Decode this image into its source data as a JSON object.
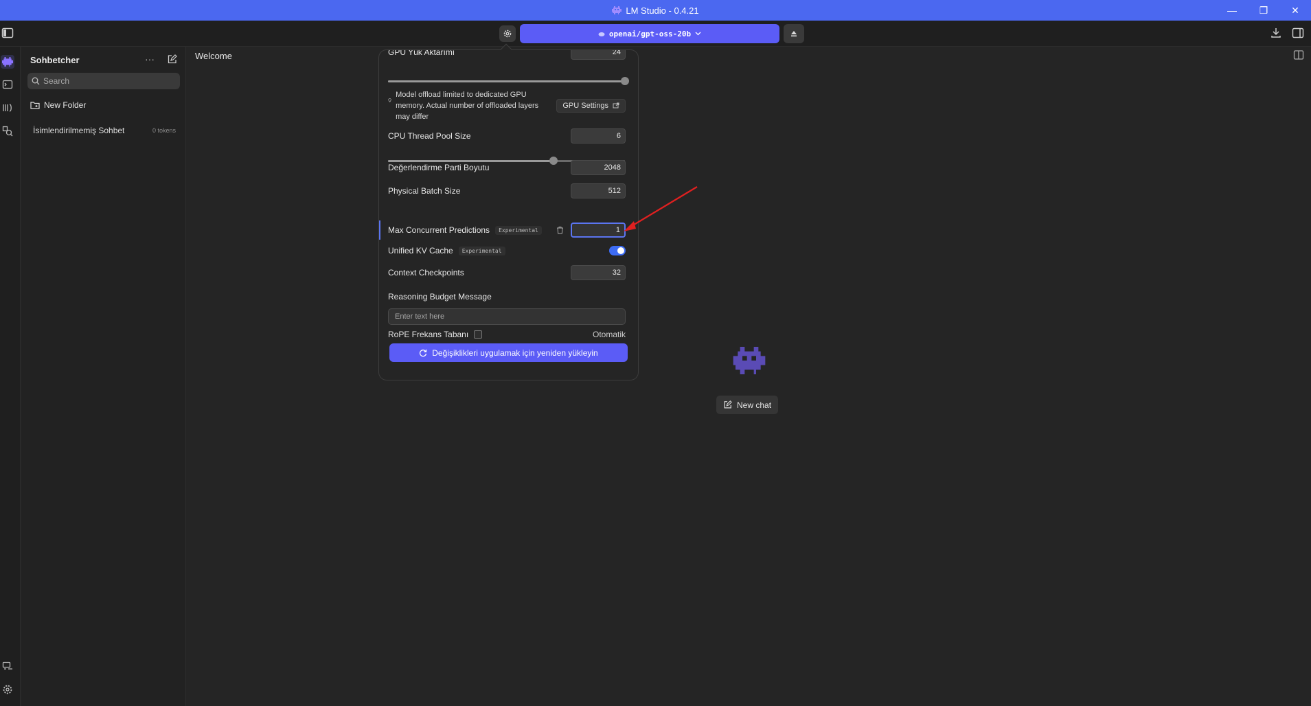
{
  "window": {
    "title": "LM Studio - 0.4.21"
  },
  "toolbar": {
    "model_name": "openai/gpt-oss-20b"
  },
  "sidebar": {
    "title": "Sohbetcher",
    "more_label": "···",
    "search_placeholder": "Search",
    "new_folder_label": "New Folder",
    "chats": [
      {
        "name": "İsimlendirilmemiş Sohbet",
        "tokens": "0 tokens"
      }
    ]
  },
  "main": {
    "tab_title": "Welcome",
    "new_chat_label": "New chat"
  },
  "settings": {
    "gpu_offload": {
      "label": "GPU Yük Aktarımı",
      "value": "24",
      "fraction": 1.0
    },
    "offload_note": "Model offload limited to dedicated GPU memory. Actual number of offloaded layers may differ",
    "gpu_settings_label": "GPU Settings",
    "cpu_thread_pool": {
      "label": "CPU Thread Pool Size",
      "value": "6",
      "fraction": 0.7
    },
    "eval_batch": {
      "label": "Değerlendirme Parti Boyutu",
      "value": "2048"
    },
    "physical_batch": {
      "label": "Physical Batch Size",
      "value": "512"
    },
    "max_concurrent": {
      "label": "Max Concurrent Predictions",
      "badge": "Experimental",
      "value": "1"
    },
    "unified_kv": {
      "label": "Unified KV Cache",
      "badge": "Experimental",
      "enabled": true
    },
    "context_checkpoints": {
      "label": "Context Checkpoints",
      "value": "32"
    },
    "reasoning_budget": {
      "label": "Reasoning Budget Message",
      "placeholder": "Enter text here"
    },
    "rope": {
      "label": "RoPE Frekans Tabanı",
      "value": "Otomatik",
      "checked": false
    },
    "reload_label": "Değişiklikleri uygulamak için yeniden yükleyin"
  },
  "colors": {
    "accent": "#5b5cf6",
    "titlebar": "#4b68f0",
    "toggle_on": "#3d6cf5",
    "annotation": "#e02020"
  }
}
